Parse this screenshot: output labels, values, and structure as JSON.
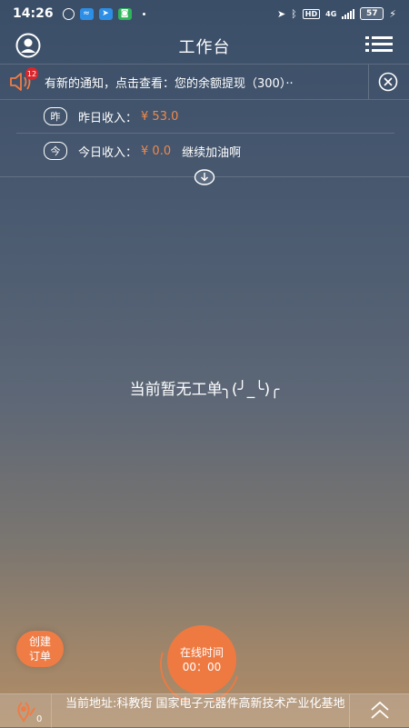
{
  "status_bar": {
    "time": "14:26",
    "network": "4G",
    "hd": "HD",
    "battery": "57"
  },
  "header": {
    "title": "工作台"
  },
  "notice": {
    "badge_count": "12",
    "text": "有新的通知，点击查看：您的余额提现（300）··"
  },
  "income": {
    "yesterday_icon_char": "昨",
    "yesterday_label": "昨日收入：",
    "yesterday_amount": "¥ 53.0",
    "today_icon_char": "今",
    "today_label": "今日收入：",
    "today_amount": "¥ 0.0",
    "today_note": "继续加油啊"
  },
  "main": {
    "empty_message": "当前暂无工单╮(╯_╰)╭"
  },
  "actions": {
    "create_line1": "创建",
    "create_line2": "订单",
    "online_label": "在线时间",
    "online_time": "00：00"
  },
  "bottom": {
    "location_count": "0",
    "address": "当前地址:科教街  国家电子元器件高新技术产业化基地"
  },
  "colors": {
    "accent": "#ee7a42",
    "amount": "#f0894a",
    "badge": "#d8262c"
  }
}
